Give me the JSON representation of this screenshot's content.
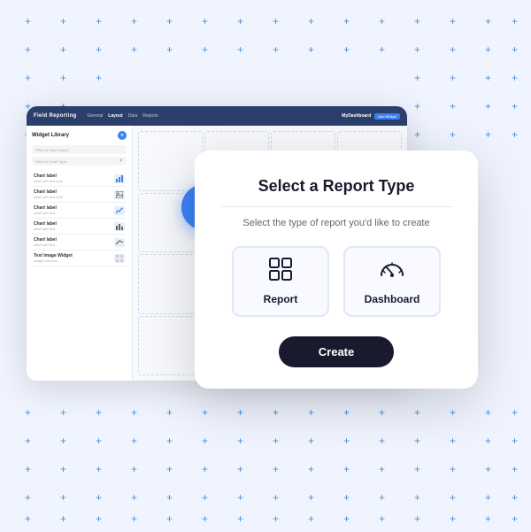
{
  "background": {
    "color": "#eef2ff"
  },
  "dashboard": {
    "topbar": {
      "logo": "Field Reporting",
      "nav_items": [
        "General",
        "Layout",
        "Data",
        "Reports"
      ],
      "active_nav": "Layout",
      "brand": "MyDashboard",
      "add_btn_label": "Add",
      "widget_btn_label": "Widget"
    },
    "sidebar": {
      "title": "Widget Library",
      "search_placeholder": "Filter by Data Source",
      "filter_placeholder": "Filter by Chart Type",
      "items": [
        {
          "label": "Chart label",
          "sub": "chart sub text"
        },
        {
          "label": "Chart label",
          "sub": "chart sub text"
        },
        {
          "label": "Chart label",
          "sub": "chart sub text"
        },
        {
          "label": "Chart label",
          "sub": "chart sub text"
        },
        {
          "label": "Chart label",
          "sub": "chart sub text"
        },
        {
          "label": "Test Image Widget",
          "sub": "sub text"
        }
      ]
    }
  },
  "plus_button": {
    "icon": "+"
  },
  "modal": {
    "title": "Select a Report Type",
    "divider": true,
    "subtitle": "Select the type of report you'd like to create",
    "options": [
      {
        "id": "report",
        "label": "Report",
        "icon": "grid"
      },
      {
        "id": "dashboard",
        "label": "Dashboard",
        "icon": "gauge"
      }
    ],
    "create_btn_label": "Create"
  }
}
